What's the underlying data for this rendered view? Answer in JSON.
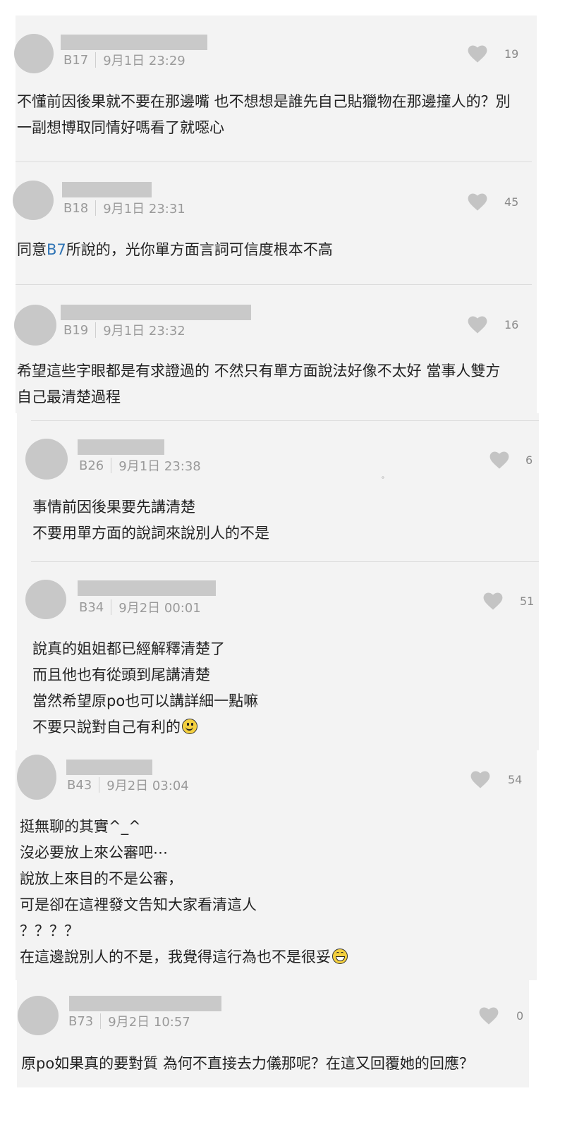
{
  "comments": [
    {
      "floor": "B17",
      "time": "9月1日 23:29",
      "likes": "19",
      "lines": [
        "不懂前因後果就不要在那邊嘴 也不想想是誰先自己貼獵物在那邊撞人的？別",
        "一副想博取同情好嗎看了就噁心"
      ]
    },
    {
      "floor": "B18",
      "time": "9月1日 23:31",
      "likes": "45",
      "mention": "B7",
      "pre": "同意",
      "post": "所說的，光你單方面言詞可信度根本不高"
    },
    {
      "floor": "B19",
      "time": "9月1日 23:32",
      "likes": "16",
      "lines": [
        "希望這些字眼都是有求證過的 不然只有單方面說法好像不太好 當事人雙方",
        "自己最清楚過程"
      ]
    },
    {
      "floor": "B26",
      "time": "9月1日 23:38",
      "likes": "6",
      "lines": [
        "事情前因後果要先講清楚",
        "不要用單方面的說詞來說別人的不是"
      ]
    },
    {
      "floor": "B34",
      "time": "9月2日 00:01",
      "likes": "51",
      "lines": [
        "說真的姐姐都已經解釋清楚了",
        "而且他也有從頭到尾講清楚",
        "當然希望原po也可以講詳細一點嘛",
        "不要只說對自己有利的"
      ]
    },
    {
      "floor": "B43",
      "time": "9月2日 03:04",
      "likes": "54",
      "lines": [
        "挺無聊的其實^_^",
        "沒必要放上來公審吧⋯",
        "說放上來目的不是公審，",
        "可是卻在這裡發文告知大家看清這人",
        "？？？？",
        "在這邊說別人的不是，我覺得這行為也不是很妥"
      ]
    },
    {
      "floor": "B73",
      "time": "9月2日 10:57",
      "likes": "0",
      "lines": [
        "原po如果真的要對質 為何不直接去力儀那呢？在這又回覆她的回應？"
      ]
    }
  ],
  "icons": {
    "like": "heart-icon",
    "smile": "smiling-face-emoji",
    "grin": "grinning-face-emoji"
  },
  "colors": {
    "card_bg": "#f3f3f3",
    "placeholder": "#c8c8c8",
    "mention": "#2f74b5",
    "heart": "#c4c4c4"
  },
  "stray_mark": "。"
}
